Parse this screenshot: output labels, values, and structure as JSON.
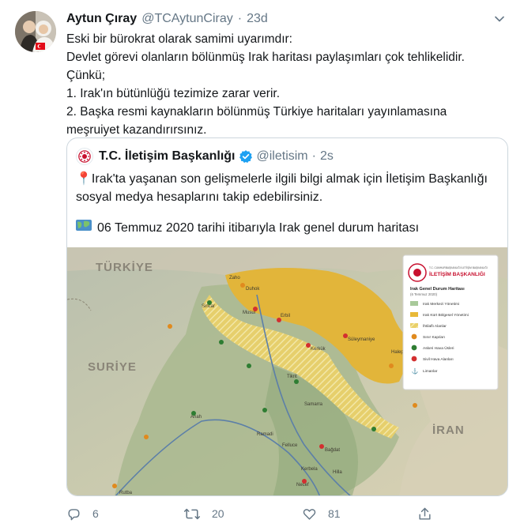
{
  "tweet": {
    "author_name": "Aytun Çıray",
    "author_handle": "@TCAytunCiray",
    "separator": "·",
    "time": "23d",
    "text_lines": [
      "Eski bir bürokrat olarak samimi uyarımdır:",
      "Devlet görevi olanların bölünmüş Irak haritası paylaşımları çok tehlikelidir.",
      "Çünkü;",
      "1. Irak'ın bütünlüğü tezimize zarar verir.",
      "2. Başka resmi kaynakların bölünmüş Türkiye haritaları yayınlamasına",
      "meşruiyet kazandırırsınız."
    ]
  },
  "quoted": {
    "name": "T.C. İletişim Başkanlığı",
    "handle": "@iletisim",
    "separator": "·",
    "time": "2s",
    "line1": "Irak'ta yaşanan son gelişmelerle ilgili bilgi almak için İletişim Başkanlığı",
    "line2": "sosyal medya hesaplarını takip edebilirsiniz.",
    "line3": "06 Temmuz 2020 tarihi itibarıyla Irak genel durum haritası",
    "pin_emoji": "📍",
    "map_emoji": "🗺️"
  },
  "map": {
    "country_labels": [
      "TÜRKİYE",
      "SURİYE",
      "İRAN"
    ],
    "legend": {
      "org_small": "T.C. CUMHURBAŞKANLIĞI İLETİŞİM BAŞKANLIĞI",
      "org": "İLETİŞİM BAŞKANLIĞI",
      "title": "Irak Genel Durum Haritası",
      "date": "(6 Temmuz 2020)",
      "items": [
        {
          "label": "Irak Merkezi Yönetimi",
          "color": "#a8c99a"
        },
        {
          "label": "Irak Kürt Bölgesel Yönetimi",
          "color": "#e8b938"
        },
        {
          "label": "İhtilaflı Alanlar",
          "color": "#e8c84a"
        },
        {
          "label": "Sınır Kapıları",
          "color": "#e08a1e"
        },
        {
          "label": "Askeri Hava Üsleri",
          "color": "#2e7d32"
        },
        {
          "label": "Sivil Hava Alanları",
          "color": "#d32f2f"
        },
        {
          "label": "Limanlar",
          "color": "#1e88e5"
        }
      ]
    },
    "cities": [
      "Duhok",
      "Zaho",
      "Erbil",
      "Kerkük",
      "Süleymaniye",
      "Musul",
      "Bağdat",
      "Ramadi",
      "Tikrit",
      "Sincar",
      "Halepçe",
      "Samarra",
      "Felluce",
      "Kerbela",
      "Necef",
      "Hilla",
      "Anah",
      "Rutba"
    ]
  },
  "actions": {
    "replies": "6",
    "retweets": "20",
    "likes": "81"
  },
  "colors": {
    "secondary_text": "#657786",
    "verified": "#1da1f2",
    "border": "#ccd6dd"
  }
}
